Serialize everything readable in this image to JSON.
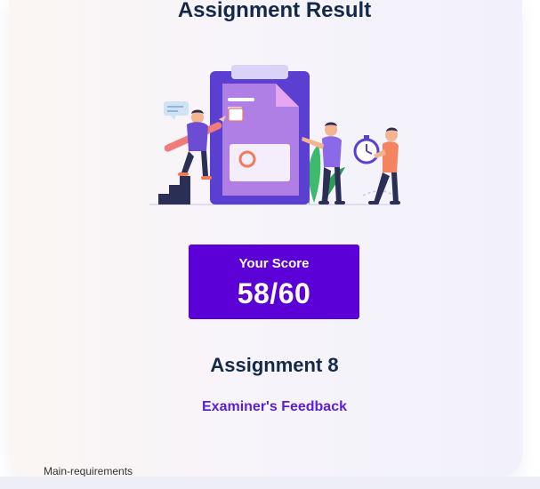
{
  "header": {
    "title": "Assignment Result"
  },
  "illustration": {
    "icon": "assignment-result-illustration"
  },
  "score": {
    "label": "Your Score",
    "value": "58/60",
    "accent_color": "#5b00d6"
  },
  "assignment": {
    "name": "Assignment 8",
    "feedback_link": "Examiner's Feedback",
    "feedback_color": "#5b1fd1"
  },
  "sections": {
    "main_requirements": "Main-requirements"
  }
}
